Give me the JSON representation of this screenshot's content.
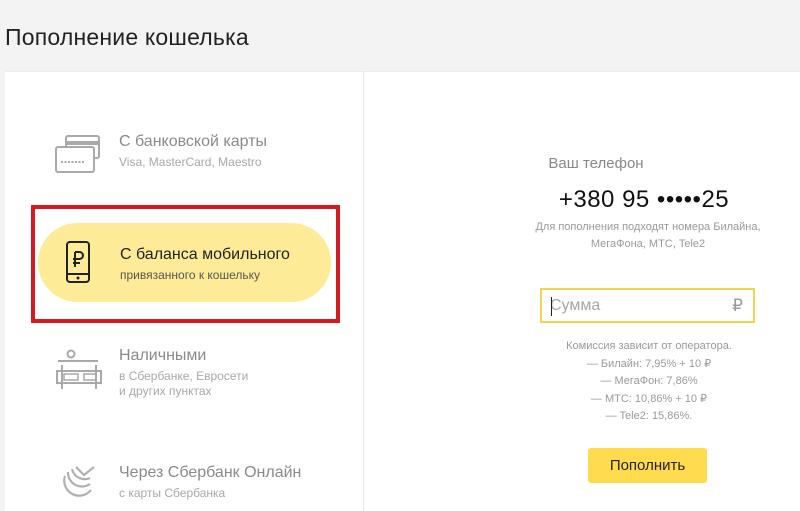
{
  "page": {
    "title": "Пополнение кошелька"
  },
  "methods": {
    "bank_card": {
      "title": "С банковской карты",
      "subtitle": "Visa, MasterCard, Maestro",
      "icon": "bank-card-icon"
    },
    "mobile_balance": {
      "title": "С баланса мобильного",
      "subtitle": "привязанного к кошельку",
      "icon": "mobile-ruble-icon",
      "selected": true
    },
    "cash": {
      "title": "Наличными",
      "subtitle_line1": "в Сбербанке, Евросети",
      "subtitle_line2": "и других пунктах",
      "icon": "cash-terminal-icon"
    },
    "sberbank_online": {
      "title": "Через Сбербанк Онлайн",
      "subtitle": "с карты Сбербанка",
      "icon": "sberbank-logo-icon"
    }
  },
  "form": {
    "phone_label": "Ваш телефон",
    "phone_number": "+380 95 •••••25",
    "phone_hint_line1": "Для пополнения подходят номера Билайна,",
    "phone_hint_line2": "МегаФона, МТС, Tele2",
    "amount_placeholder": "Сумма",
    "amount_value": "",
    "currency_symbol": "₽",
    "commission": {
      "header": "Комиссия зависит от оператора.",
      "lines": [
        "— Билайн: 7,95% + 10 ₽",
        "— МегаФон: 7,86%",
        "— МТС: 10,86% + 10 ₽",
        "— Tele2: 15,86%."
      ]
    },
    "submit_label": "Пополнить"
  },
  "colors": {
    "accent_yellow": "#ffdb4d",
    "selected_pill": "#fdeb97",
    "highlight_red": "#d61a24",
    "input_border": "#f2d54a"
  }
}
